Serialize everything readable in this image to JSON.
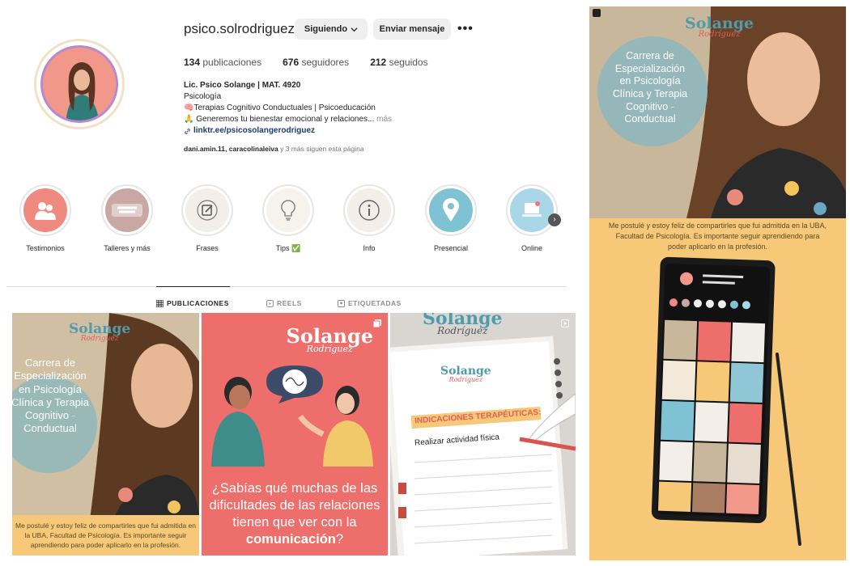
{
  "profile": {
    "username": "psico.solrodriguez",
    "follow_label": "Siguiendo",
    "message_label": "Enviar mensaje",
    "more_label": "•••",
    "stats": [
      {
        "count": "134",
        "label": "publicaciones"
      },
      {
        "count": "676",
        "label": "seguidores"
      },
      {
        "count": "212",
        "label": "seguidos"
      }
    ],
    "bio": {
      "name": "Lic. Psico Solange | MAT. 4920",
      "category": "Psicología",
      "line1": "🧠Terapias Cognitivo Conductuales | Psicoeducación",
      "line2": "🙏 Generemos tu bienestar emocional y relaciones...",
      "more": "más",
      "link": "linktr.ee/psicosolangerodriguez"
    },
    "followed_by": {
      "names": "dani.amin.11, caracolinaleiva",
      "rest": "y 3 más siguen esta página"
    }
  },
  "highlights": [
    {
      "label": "Testimonios",
      "color": "#f08a80"
    },
    {
      "label": "Talleres y más",
      "color": "#c9a8a4"
    },
    {
      "label": "Frases",
      "color": "#f3efe8"
    },
    {
      "label": "Tips ✅",
      "color": "#f6f2ec"
    },
    {
      "label": "Info",
      "color": "#f3efe8"
    },
    {
      "label": "Presencial",
      "color": "#7fc2d3"
    },
    {
      "label": "Online",
      "color": "#a9d7e8"
    }
  ],
  "tabs": [
    {
      "label": "PUBLICACIONES",
      "icon": "grid-icon"
    },
    {
      "label": "REELS",
      "icon": "reels-icon"
    },
    {
      "label": "ETIQUETADAS",
      "icon": "tagged-icon"
    }
  ],
  "posts": {
    "p1": {
      "logo": "Solange",
      "logo_sub": "Rodríguez",
      "overlay": "Carrera de\nEspecialización\nen Psicología\nClínica y Terapia\nCognitivo -\nConductual",
      "caption": "Me postulé y estoy feliz de compartirles que fui admitida en la UBA, Facultad de Psicología. Es importante seguir aprendiendo para poder aplicarlo en la profesión."
    },
    "p2": {
      "logo": "Solange",
      "logo_sub": "Rodríguez",
      "text_a": "¿Sabías qué muchas de las",
      "text_b": "dificultades de las relaciones",
      "text_c": "tienen que ver con la",
      "text_bold": "comunicación",
      "text_end": "?"
    },
    "p3": {
      "logo_top": "Solange",
      "logo_top_sub": "Rodríguez",
      "logo": "Solange",
      "logo_sub": "Rodríguez",
      "heading": "INDICACIONES TERAPÉUTICAS:",
      "line": "Realizar actividad física"
    }
  },
  "side_post": {
    "logo": "Solange",
    "logo_sub": "Rodríguez",
    "overlay": "Carrera de\nEspecialización\nen Psicología\nClínica y Terapia\nCognitivo -\nConductual",
    "caption": "Me postulé y estoy feliz de compartirles que fui admitida en la UBA, Facultad de Psicología. Es importante seguir aprendiendo para poder aplicarlo en la profesión."
  }
}
